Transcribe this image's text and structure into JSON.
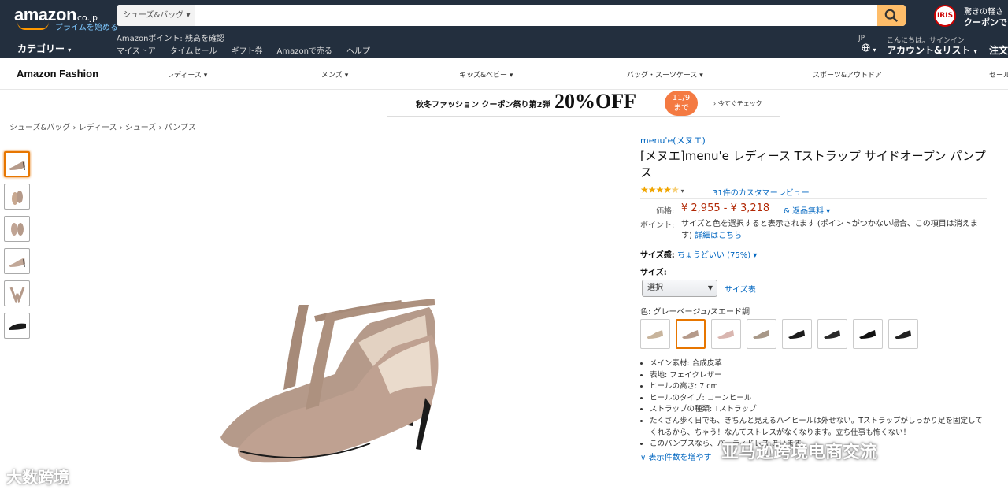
{
  "header": {
    "logo_word": "amazon",
    "logo_tld": "co.jp",
    "logo_prime": "プライムを始める",
    "search_dept": "シューズ&バッグ",
    "search_placeholder": "",
    "promo_line1": "驚きの軽さ",
    "promo_line2": "クーポンで",
    "promo_logo": "IRIS",
    "category": "カテゴリー",
    "points_text": "Amazonポイント: 残高を確認",
    "nav_links": [
      "マイストア",
      "タイムセール",
      "ギフト券",
      "Amazonで売る",
      "ヘルプ"
    ],
    "lang_code": "JP",
    "lang_icon": "globe-icon",
    "greeting": "こんにちは。サインイン",
    "account": "アカウント&リスト",
    "orders": "注文"
  },
  "fashion_nav": {
    "title": "Amazon Fashion",
    "items": [
      "レディース",
      "メンズ",
      "キッズ&ベビー",
      "バッグ・スーツケース",
      "スポーツ&アウトドア",
      "セール"
    ]
  },
  "banner": {
    "text": "秋冬ファッション クーポン祭り第2弾",
    "big": "20%OFF",
    "badge_date": "11/9",
    "badge_until": "まで",
    "check": "今すぐチェック"
  },
  "breadcrumb": "シューズ&バッグ › レディース › シューズ › パンプス",
  "product": {
    "brand": "menu'e(メヌエ)",
    "title": "[メヌエ]menu'e レディース Tストラップ サイドオープン パンプス",
    "rating_value": 4.4,
    "reviews": "31件のカスタマーレビュー",
    "price_label": "価格:",
    "price": "¥ 2,955 - ¥ 3,218",
    "ship": "& 返品無料",
    "points_label": "ポイント:",
    "points_text": "サイズと色を選択すると表示されます (ポイントがつかない場合、この項目は消えます)",
    "points_link": "詳細はこちら",
    "fit_label": "サイズ感:",
    "fit_value": "ちょうどいい (75%)",
    "size_label": "サイズ:",
    "size_select": "選択",
    "size_chart": "サイズ表",
    "color_label": "色: グレーベージュ/スエード調",
    "bullets": [
      "メイン素材: 合成皮革",
      "表地: フェイクレザー",
      "ヒールの高さ: 7 cm",
      "ヒールのタイプ: コーンヒール",
      "ストラップの種類: Tストラップ",
      "たくさん歩く日でも、きちんと見えるハイヒールは外せない。Tストラップがしっかり足を固定してくれるから、ちゃう！なんてストレスがなくなります。立ち仕事も怖くない！",
      "このパンプスなら、パーティドレス あいます。"
    ],
    "more": "表示件数を増やす"
  },
  "colors": {
    "beige": "#b59a8a",
    "black": "#1b1b1b",
    "link": "#0066c0",
    "price": "#b12704",
    "star": "#f0a500",
    "nav_bg": "#232f3e",
    "search_btn": "#febd69",
    "badge": "#f47a42"
  },
  "watermarks": {
    "left": "大数跨境",
    "right": "亚马逊跨境电商交流"
  }
}
